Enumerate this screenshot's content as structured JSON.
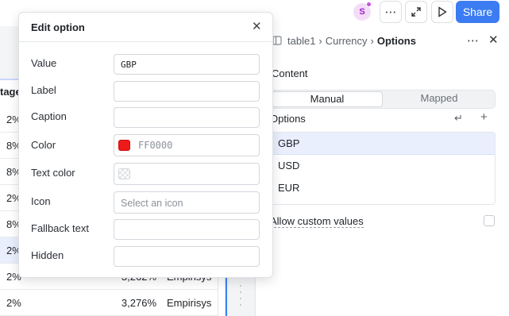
{
  "toolbar": {
    "avatar_initial": "S",
    "share_label": "Share",
    "brand_color": "#3b7cf2",
    "icons": [
      "more-icon",
      "expand-icon",
      "play-icon"
    ]
  },
  "table": {
    "column_header": "tage",
    "rows": [
      {
        "c1": "2%",
        "c2": "",
        "c3": ""
      },
      {
        "c1": "8%",
        "c2": "",
        "c3": ""
      },
      {
        "c1": "8%",
        "c2": "",
        "c3": ""
      },
      {
        "c1": "2%",
        "c2": "",
        "c3": ""
      },
      {
        "c1": "8%",
        "c2": "",
        "c3": ""
      },
      {
        "c1": "2%",
        "c2": "",
        "c3": ""
      },
      {
        "c1": "2%",
        "c2": "3,262%",
        "c3": "Empirisys"
      },
      {
        "c1": "2%",
        "c2": "3,276%",
        "c3": "Empirisys"
      }
    ]
  },
  "inspector": {
    "breadcrumb": [
      "table1",
      "Currency",
      "Options"
    ],
    "section_title": "Content",
    "tabs": {
      "manual": "Manual",
      "mapped": "Mapped"
    },
    "options_label": "Options",
    "options": [
      "GBP",
      "USD",
      "EUR"
    ],
    "allow_custom": "Allow custom values"
  },
  "dialog": {
    "title": "Edit option",
    "fields": {
      "value": {
        "label": "Value",
        "value": "GBP"
      },
      "label": {
        "label": "Label",
        "value": ""
      },
      "caption": {
        "label": "Caption",
        "value": ""
      },
      "color": {
        "label": "Color",
        "placeholder": "FF0000",
        "swatch": "#ee1a1a"
      },
      "text_color": {
        "label": "Text color",
        "value": ""
      },
      "icon": {
        "label": "Icon",
        "placeholder": "Select an icon"
      },
      "fallback_text": {
        "label": "Fallback text",
        "value": ""
      },
      "hidden": {
        "label": "Hidden",
        "value": ""
      }
    }
  }
}
